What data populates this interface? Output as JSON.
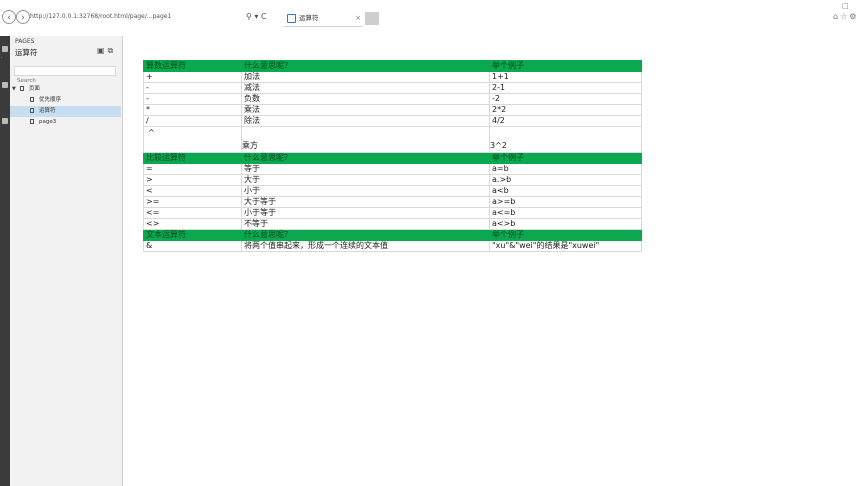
{
  "browser": {
    "address": "http://127.0.0.1:32768/root.html/page/...page1",
    "tab_title": "运算符",
    "tab_close": "×",
    "tools": "⚲ ▾ C"
  },
  "sidebar": {
    "section_label": "PAGES",
    "title": "运算符",
    "search_placeholder": "Search",
    "tree": {
      "root": "页面",
      "items": [
        "优先顺序",
        "运算符",
        "page3"
      ]
    }
  },
  "table": {
    "sections": [
      {
        "header": [
          "算数运算符",
          "什么意思呢？",
          "举个例子"
        ],
        "rows": [
          [
            "+",
            "加法",
            "1+1"
          ],
          [
            "-",
            "减法",
            "2-1"
          ],
          [
            "-",
            "负数",
            "-2"
          ],
          [
            "*",
            "乘法",
            "2*2"
          ],
          [
            "/",
            "除法",
            "4/2"
          ],
          [
            "^",
            "乘方",
            "3^2"
          ]
        ]
      },
      {
        "header": [
          "比较运算符",
          "什么意思呢？",
          "举个例子"
        ],
        "rows": [
          [
            "=",
            "等于",
            "a=b"
          ],
          [
            ">",
            "大于",
            "a.>b"
          ],
          [
            "<",
            "小于",
            "a<b"
          ],
          [
            ">=",
            "大于等于",
            "a>=b"
          ],
          [
            "<=",
            "小于等于",
            "a<=b"
          ],
          [
            "<>",
            "不等于",
            "a<>b"
          ]
        ]
      },
      {
        "header": [
          "文本运算符",
          "什么意思呢？",
          "举个例子"
        ],
        "rows": [
          [
            "&",
            "将两个值串起来，形成一个连续的文本值",
            "\"xu\"&\"wei\"的结果是\"xuwei\""
          ]
        ]
      }
    ]
  }
}
